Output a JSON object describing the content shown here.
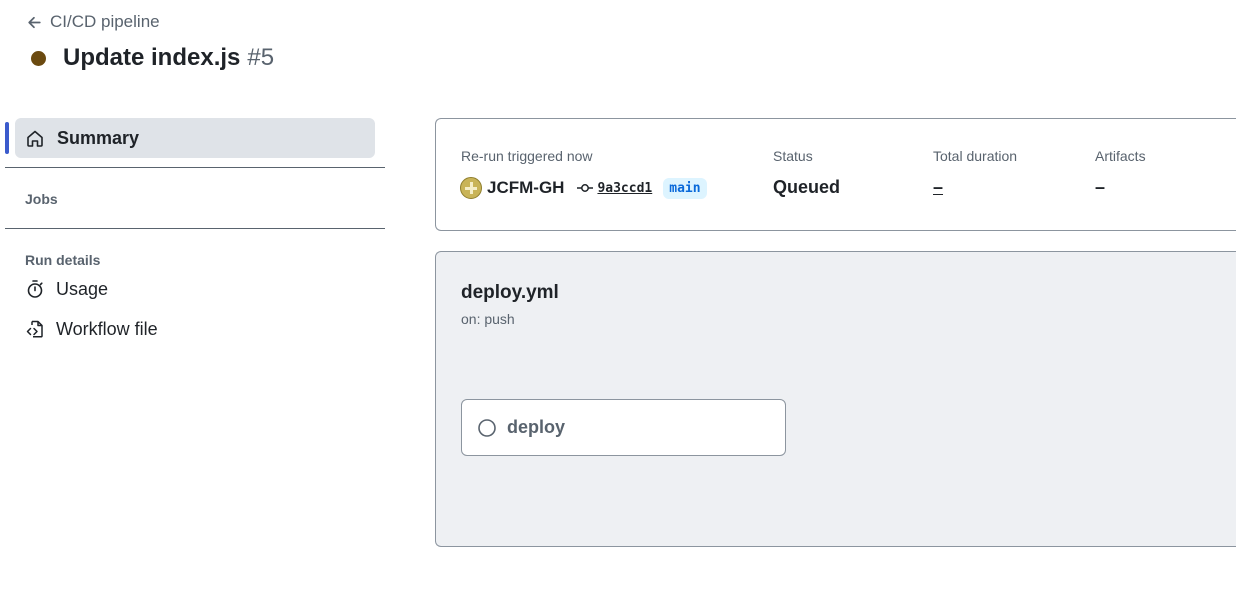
{
  "header": {
    "back_label": "CI/CD pipeline",
    "title": "Update index.js",
    "run_number": "#5",
    "status_color": "#6b4a10"
  },
  "sidebar": {
    "summary_label": "Summary",
    "jobs_section": "Jobs",
    "run_details_section": "Run details",
    "items": [
      {
        "label": "Usage",
        "icon": "stopwatch-icon"
      },
      {
        "label": "Workflow file",
        "icon": "file-code-icon"
      }
    ]
  },
  "summary": {
    "trigger_label": "Re-run triggered now",
    "actor": "JCFM-GH",
    "commit": "9a3ccd1",
    "branch": "main",
    "status_label": "Status",
    "status_value": "Queued",
    "duration_label": "Total duration",
    "duration_value": "–",
    "artifacts_label": "Artifacts",
    "artifacts_value": "–"
  },
  "workflow": {
    "name": "deploy.yml",
    "trigger": "on: push",
    "jobs": [
      {
        "name": "deploy",
        "status": "queued"
      }
    ]
  },
  "colors": {
    "accent": "#3b5bcc",
    "link": "#0969da",
    "branch_bg": "#ddf4ff",
    "graph_bg": "#eef0f3"
  }
}
